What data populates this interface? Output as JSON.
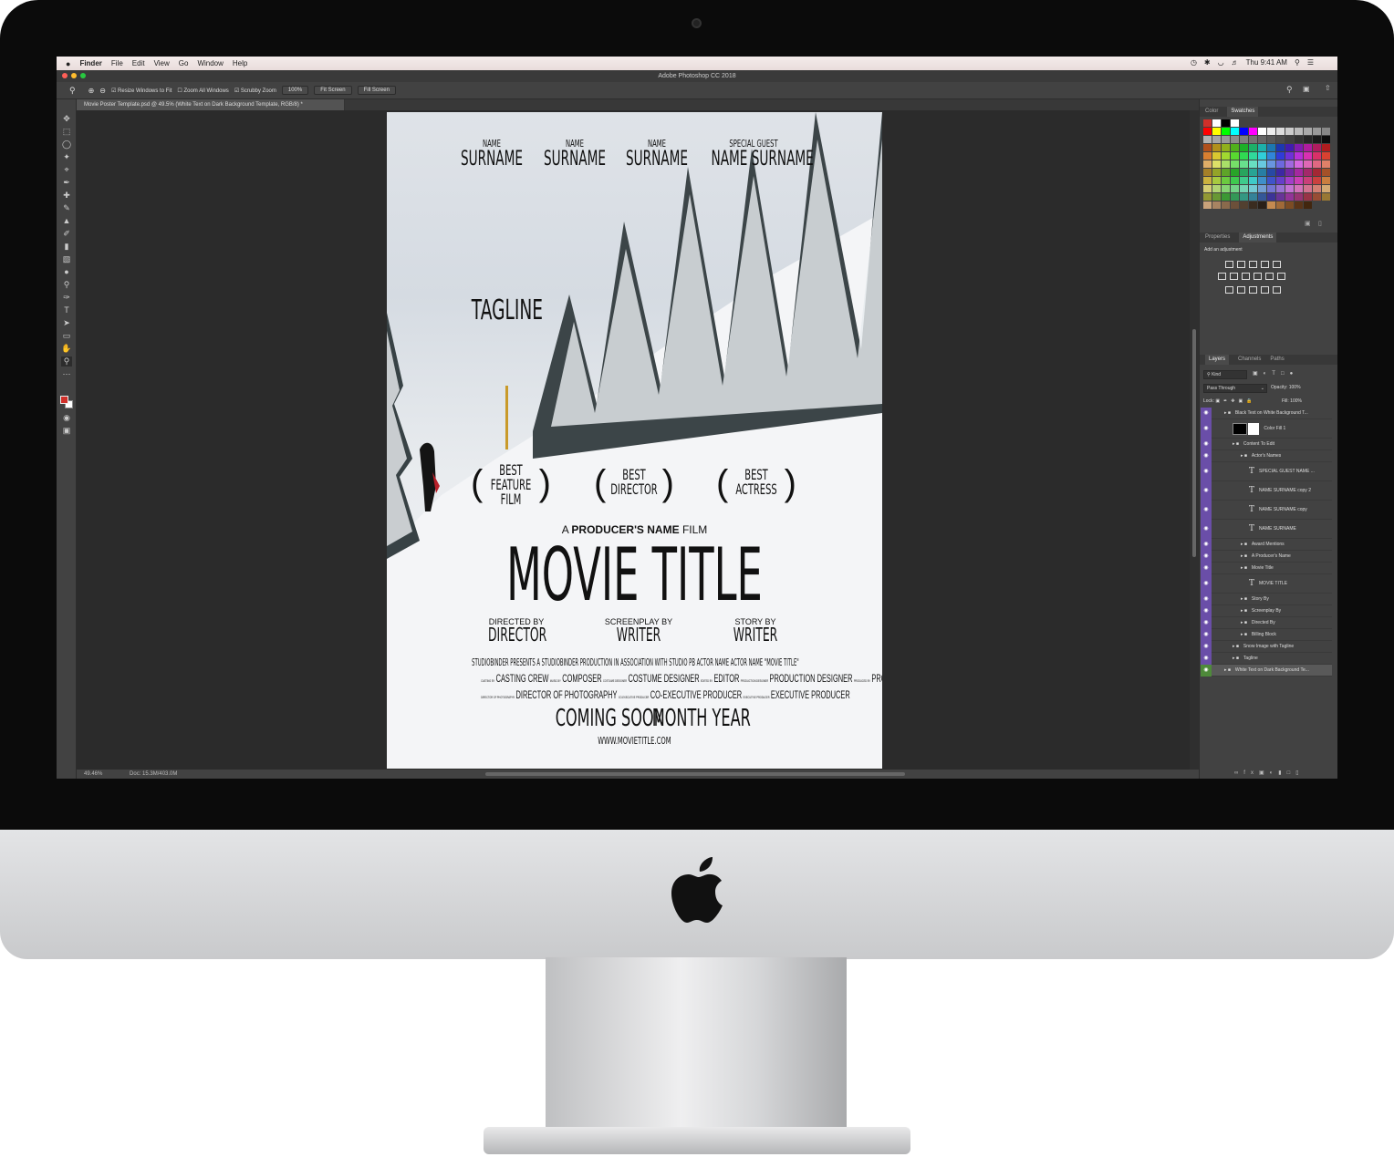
{
  "menubar": {
    "app": "Finder",
    "items": [
      "File",
      "Edit",
      "View",
      "Go",
      "Window",
      "Help"
    ],
    "clock": "Thu 9:41 AM"
  },
  "window": {
    "title": "Adobe Photoshop CC 2018"
  },
  "options": {
    "resize": "Resize Windows to Fit",
    "zoom_all": "Zoom All Windows",
    "scrubby": "Scrubby Zoom",
    "zoom_value": "100%",
    "fit_screen": "Fit Screen",
    "fill_screen": "Fill Screen"
  },
  "document_tab": "Movie Poster Template.psd @ 49.5% (White Text on Dark Background Template, RGB/8) *",
  "status": {
    "zoom": "49.46%",
    "doc": "Doc: 15.3M/403.0M"
  },
  "poster": {
    "credits": [
      {
        "top": "NAME",
        "bottom": "SURNAME"
      },
      {
        "top": "NAME",
        "bottom": "SURNAME"
      },
      {
        "top": "NAME",
        "bottom": "SURNAME"
      },
      {
        "top": "SPECIAL GUEST",
        "bottom": "NAME SURNAME"
      }
    ],
    "tagline": "TAGLINE",
    "awards": [
      [
        "BEST",
        "FEATURE",
        "FILM"
      ],
      [
        "BEST",
        "DIRECTOR"
      ],
      [
        "BEST",
        "ACTRESS"
      ]
    ],
    "producer_line_prefix": "A ",
    "producer_line_bold": "PRODUCER'S NAME",
    "producer_line_suffix": " FILM",
    "movie_title": "MOVIE TITLE",
    "crew": [
      {
        "label": "DIRECTED BY",
        "name": "DIRECTOR"
      },
      {
        "label": "SCREENPLAY BY",
        "name": "WRITER"
      },
      {
        "label": "STORY BY",
        "name": "WRITER"
      }
    ],
    "billing_line_1": "STUDIOBINDER PRESENTS A STUDIOBINDER PRODUCTION IN ASSOCIATION WITH STUDIO PB ACTOR NAME ACTOR NAME \"MOVIE TITLE\"",
    "billing_line_2": [
      {
        "small": "CASTING BY",
        "big": "CASTING CREW"
      },
      {
        "small": "MUSIC BY",
        "big": "COMPOSER"
      },
      {
        "small": "COSTUME DESIGNER",
        "big": "COSTUME DESIGNER"
      },
      {
        "small": "EDITED BY",
        "big": "EDITOR"
      },
      {
        "small": "PRODUCTION DESIGNER",
        "big": "PRODUCTION DESIGNER"
      },
      {
        "small": "PRODUCED BY",
        "big": "PRODUCER"
      }
    ],
    "billing_line_3": [
      {
        "small": "DIRECTOR OF PHOTOGRAPHY",
        "big": "DIRECTOR OF PHOTOGRAPHY"
      },
      {
        "small": "CO-EXECUTIVE PRODUCER",
        "big": "CO-EXECUTIVE PRODUCER"
      },
      {
        "small": "EXECUTIVE PRODUCER",
        "big": "EXECUTIVE PRODUCER"
      }
    ],
    "release_left": "COMING SOON",
    "release_right": "MONTH YEAR",
    "website": "WWW.MOVIETITLE.COM"
  },
  "panels": {
    "color_tabs": [
      "Color",
      "Swatches"
    ],
    "adjust_tabs": [
      "Properties",
      "Adjustments"
    ],
    "add_adjustment": "Add an adjustment",
    "layer_tabs": [
      "Layers",
      "Channels",
      "Paths"
    ],
    "kind": "Kind",
    "blend": "Pass Through",
    "opacity_label": "Opacity:",
    "opacity": "100%",
    "lock_label": "Lock:",
    "fill_label": "Fill:",
    "fill": "100%"
  },
  "layers": [
    {
      "name": "Black Text on White Background T...",
      "kind": "group",
      "indent": 1
    },
    {
      "name": "Color Fill 1",
      "kind": "fill",
      "indent": 2
    },
    {
      "name": "Content To Edit",
      "kind": "group",
      "indent": 2
    },
    {
      "name": "Actor's Names",
      "kind": "group",
      "indent": 3
    },
    {
      "name": "SPECIAL GUEST NAME ...",
      "kind": "text",
      "indent": 4
    },
    {
      "name": "NAME SURNAME copy 2",
      "kind": "text",
      "indent": 4
    },
    {
      "name": "NAME SURNAME copy",
      "kind": "text",
      "indent": 4
    },
    {
      "name": "NAME SURNAME",
      "kind": "text",
      "indent": 4
    },
    {
      "name": "Award Mentions",
      "kind": "group",
      "indent": 3
    },
    {
      "name": "A Producer's Name",
      "kind": "group",
      "indent": 3
    },
    {
      "name": "Movie Title",
      "kind": "group",
      "indent": 3
    },
    {
      "name": "MOVIE TITLE",
      "kind": "text",
      "indent": 4
    },
    {
      "name": "Story By",
      "kind": "group",
      "indent": 3
    },
    {
      "name": "Screenplay By",
      "kind": "group",
      "indent": 3
    },
    {
      "name": "Directed By",
      "kind": "group",
      "indent": 3
    },
    {
      "name": "Billing Block",
      "kind": "group",
      "indent": 3
    },
    {
      "name": "Snow Image with Tagline",
      "kind": "group",
      "indent": 2
    },
    {
      "name": "Tagline",
      "kind": "group",
      "indent": 2
    },
    {
      "name": "White Text on Dark Background Te...",
      "kind": "group",
      "indent": 1
    }
  ],
  "colors": {
    "accent_eye": "#6a4ea8",
    "selected_eye": "#4e8a3a",
    "foreground": "#d0302a",
    "background": "#ffffff"
  }
}
